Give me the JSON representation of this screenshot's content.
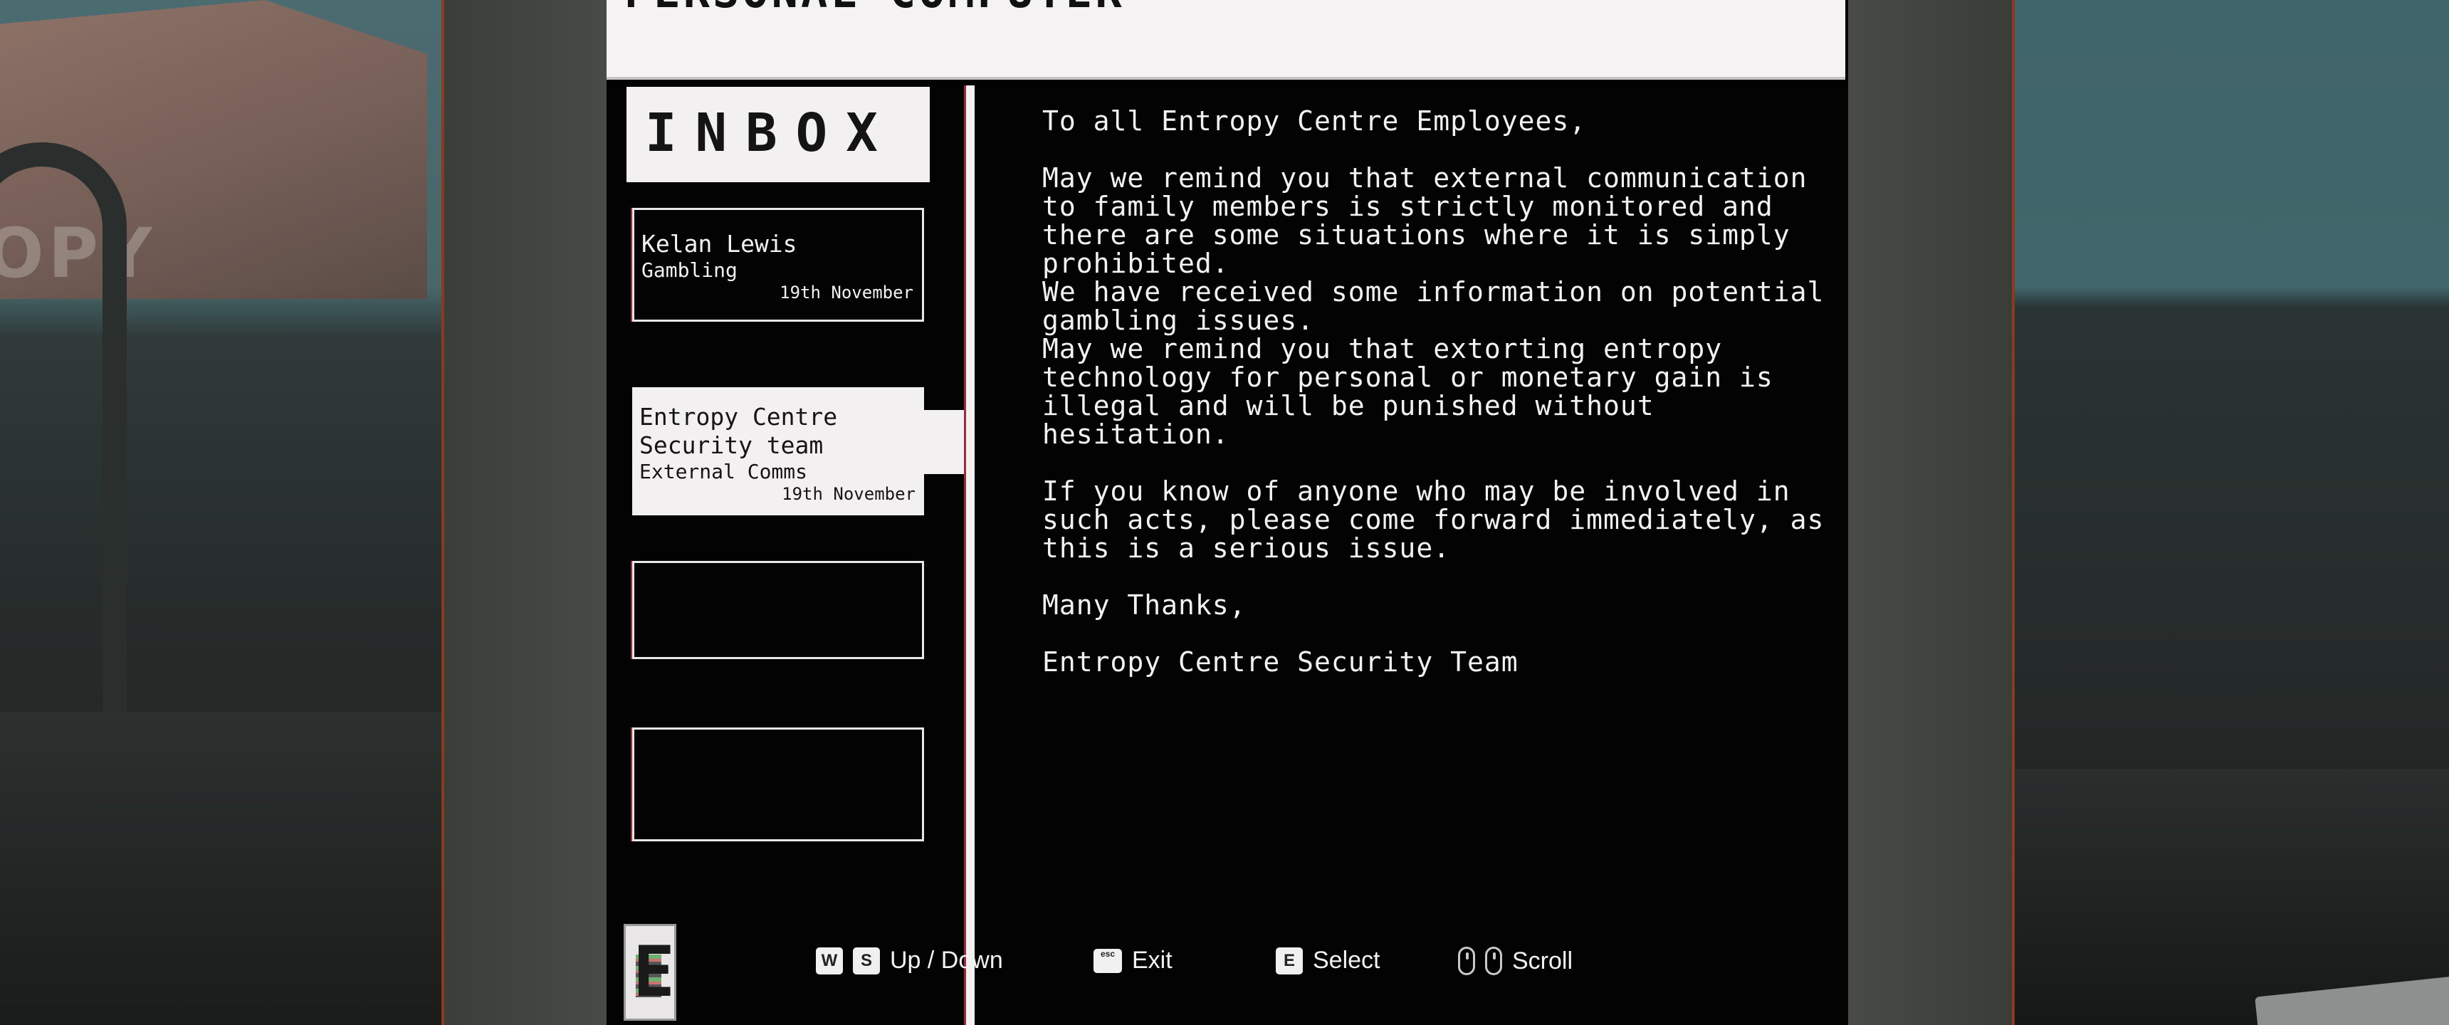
{
  "window": {
    "title": "PERSONAL COMPUTER"
  },
  "inbox": {
    "heading": "INBOX",
    "messages": [
      {
        "sender": "Kelan Lewis",
        "subject": "Gambling",
        "date": "19th November",
        "selected": false
      },
      {
        "sender": "Entropy Centre\nSecurity team",
        "subject": "External Comms",
        "date": "19th November",
        "selected": true
      },
      {
        "sender": "",
        "subject": "",
        "date": "",
        "selected": false
      },
      {
        "sender": "",
        "subject": "",
        "date": "",
        "selected": false
      }
    ]
  },
  "message_body": {
    "greeting": "To all Entropy Centre Employees,",
    "p1": "May we remind you that external communication to family members is strictly monitored and there are some situations where it is simply prohibited.",
    "p2": "We have received some information on potential gambling issues.",
    "p3": "May we remind you that extorting entropy technology for personal or monetary gain is illegal and will be punished without hesitation.",
    "p4": "If you know of anyone who may be involved in such acts, please come forward immediately, as this is a serious issue.",
    "closing": "Many Thanks,",
    "signature": "Entropy Centre Security Team"
  },
  "environment": {
    "wall_sign": "OPY"
  },
  "controls": {
    "up_key": "W",
    "down_key": "S",
    "updown_label": "Up / Down",
    "exit_key": "esc",
    "exit_label": "Exit",
    "select_key": "E",
    "select_label": "Select",
    "scroll_label": "Scroll"
  },
  "app_icon": {
    "glyph": "E"
  }
}
